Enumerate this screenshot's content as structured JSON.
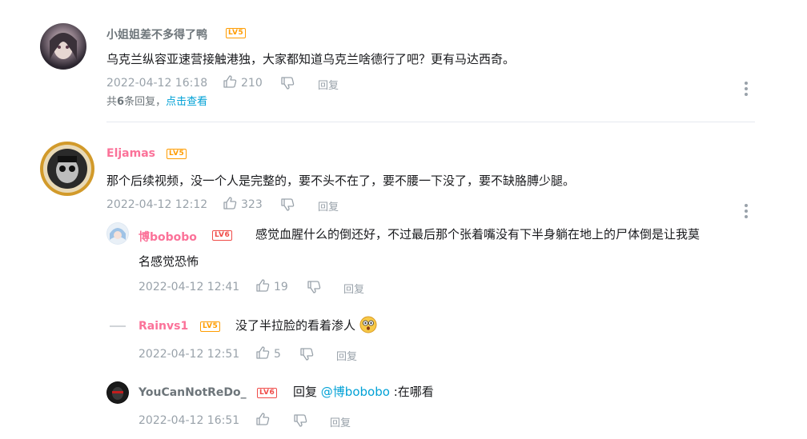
{
  "comments": [
    {
      "user": "小姐姐差不多得了鸭",
      "level": "LV5",
      "text": "乌克兰纵容亚速营接触港独，大家都知道乌克兰啥德行了吧？更有马达西奇。",
      "time": "2022-04-12 16:18",
      "likes": "210",
      "reply_label": "回复",
      "replies_summary_prefix": "共",
      "replies_summary_count": "6",
      "replies_summary_suffix": "条回复，",
      "replies_link": "点击查看"
    },
    {
      "user": "Eljamas",
      "level": "LV5",
      "text": "那个后续视频，没一个人是完整的，要不头不在了，要不腰一下没了，要不缺胳膊少腿。",
      "time": "2022-04-12 12:12",
      "likes": "323",
      "reply_label": "回复",
      "replies": [
        {
          "user": "博bobobo",
          "level": "LV6",
          "text_line1": "感觉血腥什么的倒还好，不过最后那个张着嘴没有下半身躺在地上的尸体倒是让我莫",
          "text_line2": "名感觉恐怖",
          "time": "2022-04-12 12:41",
          "likes": "19",
          "reply_label": "回复"
        },
        {
          "user": "Rainvs1",
          "level": "LV5",
          "text": "没了半拉脸的看着渗人",
          "time": "2022-04-12 12:51",
          "likes": "5",
          "reply_label": "回复"
        },
        {
          "user": "YouCanNotReDo_",
          "level": "LV6",
          "text_prefix": "回复",
          "mention": "@博bobobo",
          "text_suffix": ":在哪看",
          "time": "2022-04-12 16:51",
          "reply_label": "回复"
        }
      ]
    }
  ],
  "colors": {
    "lv5": "#ff9c00",
    "lv6": "#f04c49",
    "pink_name": "#fb7299",
    "link": "#00a1d6",
    "meta": "#99a2aa"
  }
}
